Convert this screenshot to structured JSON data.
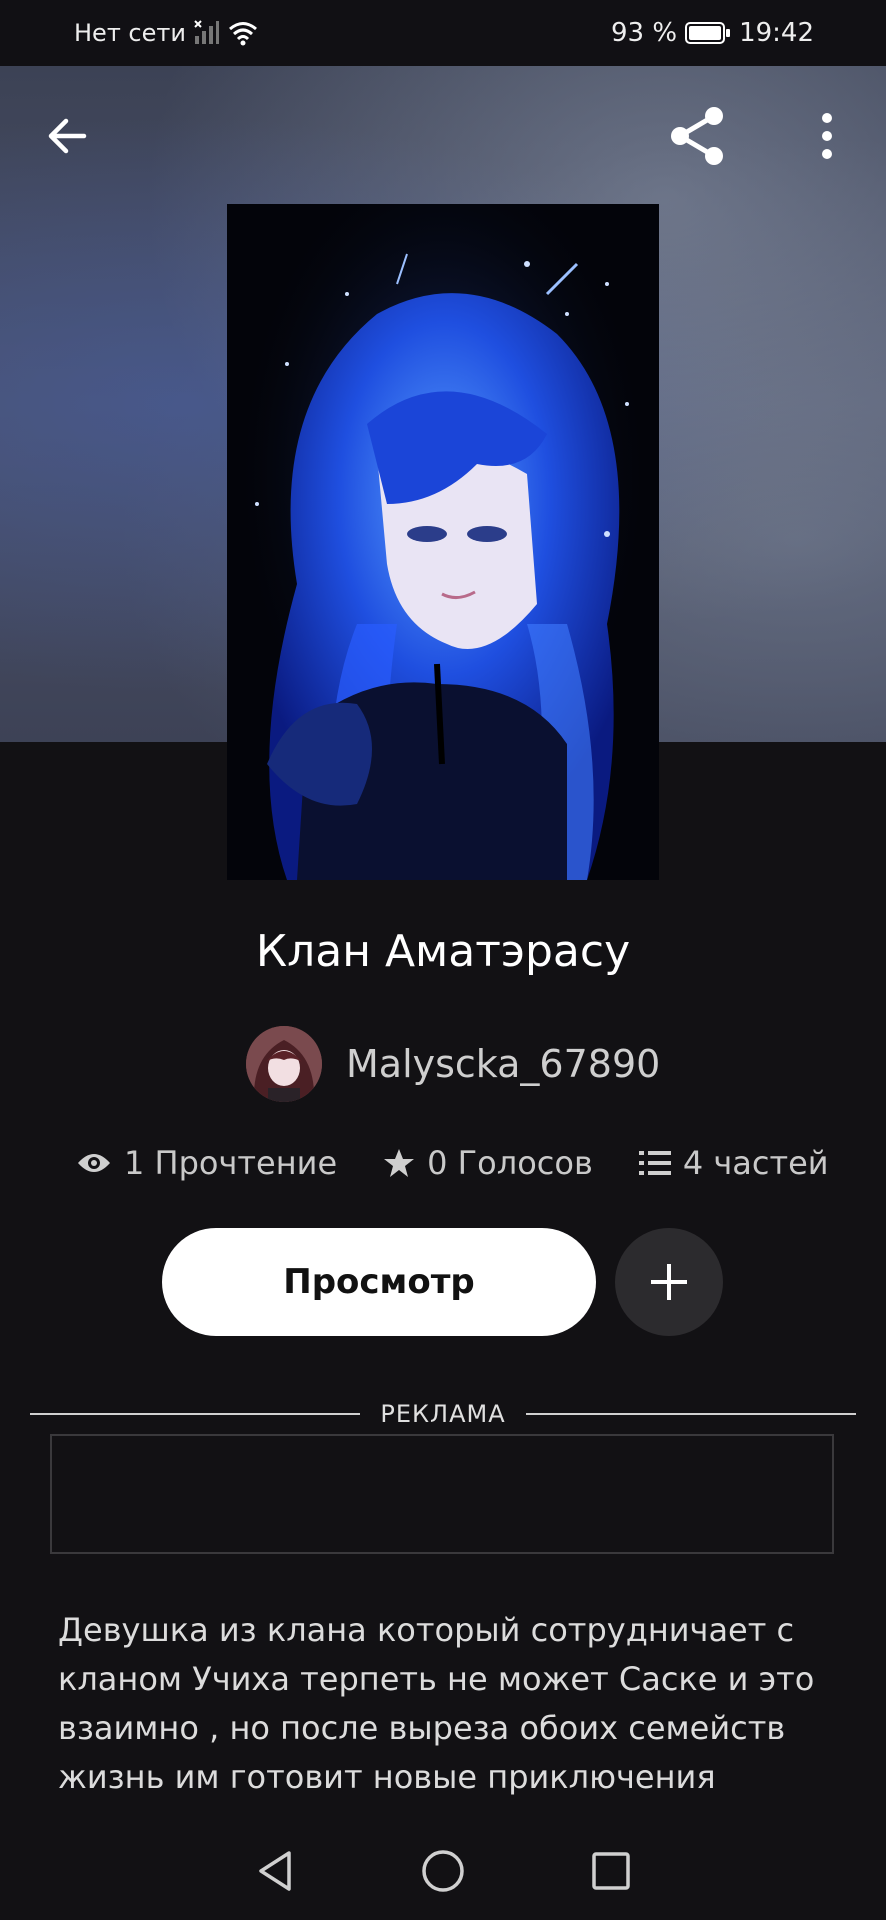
{
  "status_bar": {
    "network": "Нет сети",
    "battery": "93 %",
    "time": "19:42"
  },
  "story": {
    "title": "Клан Аматэрасу",
    "author": "Malyscka_67890",
    "stats": {
      "reads": "1 Прочтение",
      "votes": "0 Голосов",
      "parts": "4 частей"
    },
    "view_button": "Просмотр",
    "description": "Девушка из клана который сотрудничает с кланом Учиха терпеть не может Саске и это взаимно , но после выреза обоих семейств жизнь им готовит новые приключения"
  },
  "ad": {
    "label": "РЕКЛАМА"
  },
  "icons": {
    "back": "arrow-left-icon",
    "share": "share-icon",
    "more": "more-vertical-icon",
    "eye": "eye-icon",
    "star": "star-icon",
    "list": "list-icon",
    "add": "plus-icon"
  },
  "colors": {
    "background": "#121114",
    "button_primary": "#ffffff",
    "button_secondary": "#2c2b2e"
  }
}
